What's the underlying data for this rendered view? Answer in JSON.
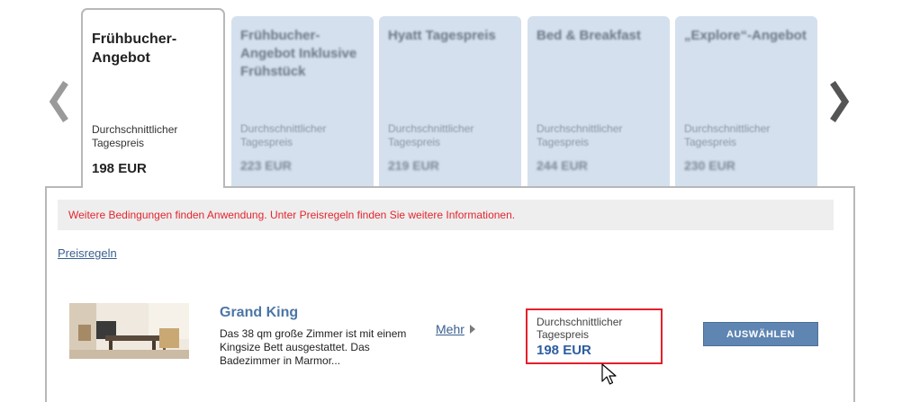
{
  "nav": {
    "prev_icon": "chevron-left-icon",
    "next_icon": "chevron-right-icon"
  },
  "rate_tabs": [
    {
      "name": "Frühbucher-Angebot",
      "sub_label": "Durchschnittlicher Tagespreis",
      "price": "198 EUR",
      "active": true
    },
    {
      "name": "Frühbucher-Angebot Inklusive Frühstück",
      "sub_label": "Durchschnittlicher Tagespreis",
      "price": "223 EUR",
      "active": false
    },
    {
      "name": "Hyatt Tagespreis",
      "sub_label": "Durchschnittlicher Tagespreis",
      "price": "219 EUR",
      "active": false
    },
    {
      "name": "Bed & Breakfast",
      "sub_label": "Durchschnittlicher Tagespreis",
      "price": "244 EUR",
      "active": false
    },
    {
      "name": "„Explore“-Angebot",
      "sub_label": "Durchschnittlicher Tagespreis",
      "price": "230 EUR",
      "active": false
    }
  ],
  "panel": {
    "notice": "Weitere Bedingungen finden Anwendung. Unter Preisregeln finden Sie weitere Informationen.",
    "rules_link": "Preisregeln",
    "room": {
      "name": "Grand King",
      "description": "Das 38 qm große Zimmer ist mit einem Kingsize Bett ausgestattet. Das Badezimmer in Marmor...",
      "more_link": "Mehr",
      "price_label": "Durchschnittlicher Tagespreis",
      "price": "198 EUR",
      "select_button": "AUSWÄHLEN"
    }
  },
  "colors": {
    "tab_bg": "#d4e0ee",
    "notice_text": "#e3262e",
    "link": "#3a5f8f",
    "button": "#5f85b2",
    "highlight_border": "#e4202a"
  }
}
